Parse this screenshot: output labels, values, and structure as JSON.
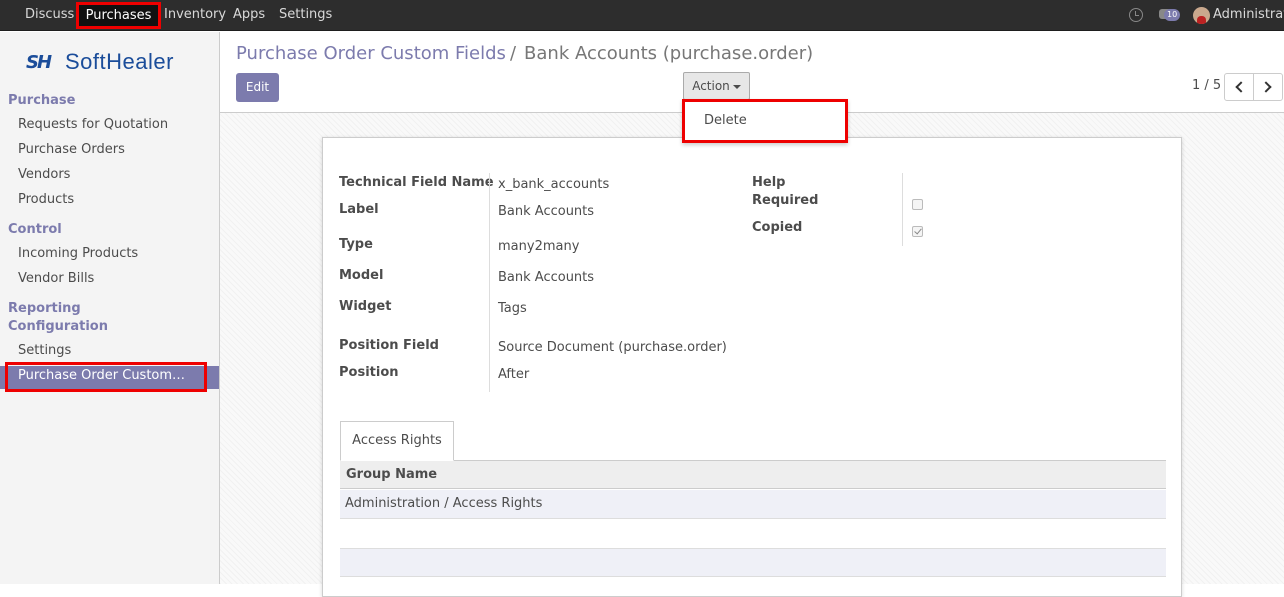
{
  "topbar": {
    "menu": [
      "Discuss",
      "Purchases",
      "Inventory",
      "Apps",
      "Settings"
    ],
    "chat_count": "10",
    "user": "Administrator"
  },
  "sidebar": {
    "logo_text": "SoftHealer",
    "logo_mark": "SH",
    "sections": [
      {
        "title": "Purchase",
        "items": [
          "Requests for Quotation",
          "Purchase Orders",
          "Vendors",
          "Products"
        ]
      },
      {
        "title": "Control",
        "items": [
          "Incoming Products",
          "Vendor Bills"
        ]
      },
      {
        "title": "Reporting"
      },
      {
        "title": "Configuration",
        "items": [
          "Settings",
          "Purchase Order Custom F…"
        ]
      }
    ]
  },
  "control": {
    "breadcrumb_parent": "Purchase Order Custom Fields",
    "breadcrumb_sep": "/",
    "breadcrumb_current": "Bank Accounts (purchase.order)",
    "edit_label": "Edit",
    "action_label": "Action",
    "dropdown_delete": "Delete",
    "pager": "1 / 5"
  },
  "form": {
    "fields": [
      {
        "label": "Technical Field Name",
        "value": "x_bank_accounts"
      },
      {
        "label": "Label",
        "value": "Bank Accounts"
      },
      {
        "label": "Type",
        "value": "many2many"
      },
      {
        "label": "Model",
        "value": "Bank Accounts"
      },
      {
        "label": "Widget",
        "value": "Tags"
      },
      {
        "label": "Position Field",
        "value": "Source Document (purchase.order)"
      },
      {
        "label": "Position",
        "value": "After"
      }
    ],
    "right_fields": [
      {
        "label": "Help"
      },
      {
        "label": "Required",
        "checked": false
      },
      {
        "label": "Copied",
        "checked": true
      }
    ],
    "tab_label": "Access Rights",
    "table_header": "Group Name",
    "table_rows": [
      "Administration / Access Rights"
    ]
  }
}
